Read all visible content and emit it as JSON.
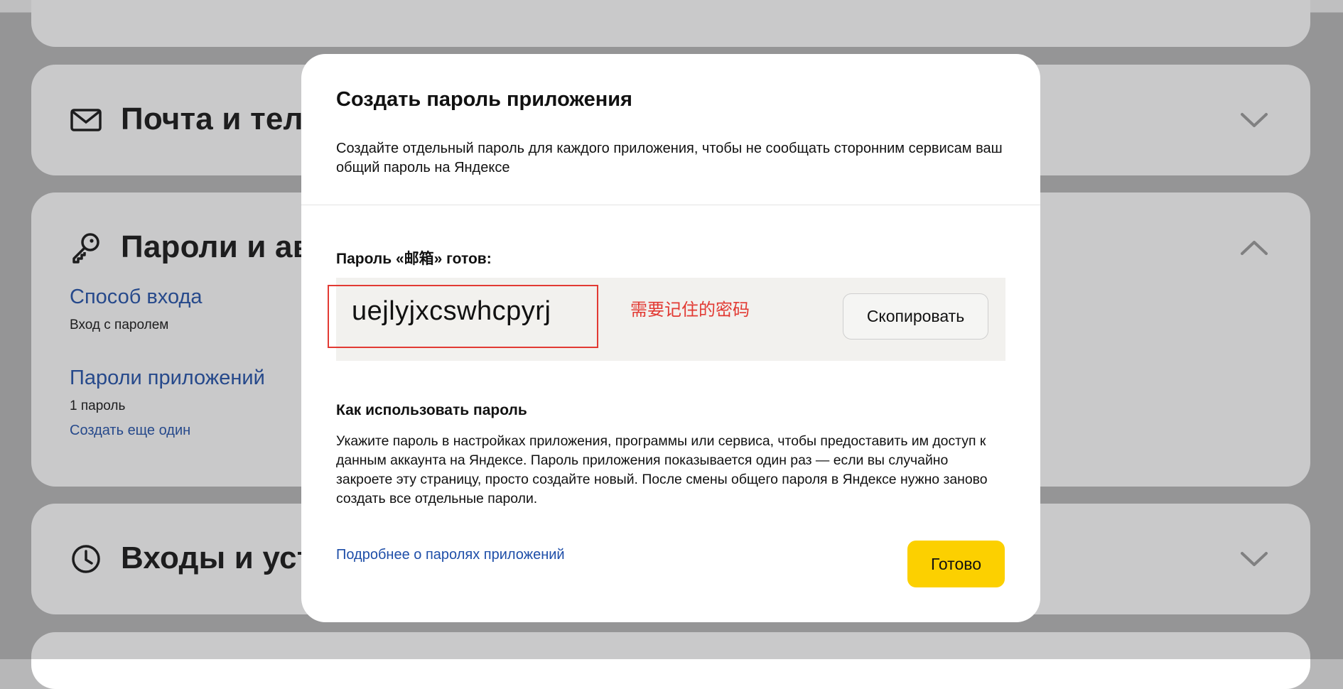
{
  "background": {
    "mail_card": {
      "title": "Почта и теле",
      "icon": "envelope-icon",
      "toggle_icon": "chevron-down-icon"
    },
    "passwords_card": {
      "title": "Пароли и авт",
      "icon": "key-icon",
      "toggle_icon": "chevron-up-icon",
      "login_method": {
        "title": "Способ входа",
        "value": "Вход с паролем"
      },
      "app_passwords": {
        "title": "Пароли приложений",
        "count": "1 пароль",
        "create_link": "Создать еще один"
      }
    },
    "logins_card": {
      "title": "Входы и устр",
      "icon": "clock-icon",
      "toggle_icon": "chevron-down-icon"
    }
  },
  "modal": {
    "title": "Создать пароль приложения",
    "description": "Создайте отдельный пароль для каждого приложения, чтобы не сообщать сторонним сервисам ваш общий пароль на Яндексе",
    "ready_label": "Пароль «邮箱» готов:",
    "password": "uejlyjxcswhcpyrj",
    "annotation": "需要记住的密码",
    "copy_button": "Скопировать",
    "howto_title": "Как использовать пароль",
    "howto_text": "Укажите пароль в настройках приложения, программы или сервиса, чтобы предоставить им доступ к данным аккаунта на Яндексе. Пароль приложения показывается один раз — если вы случайно закроете эту страницу, просто создайте новый. После смены общего пароля в Яндексе нужно заново создать все отдельные пароли.",
    "more_link": "Подробнее о паролях приложений",
    "done_button": "Готово"
  },
  "colors": {
    "accent_yellow": "#fcd000",
    "link_blue": "#1e4ea8",
    "annotation_red": "#e23a33"
  }
}
